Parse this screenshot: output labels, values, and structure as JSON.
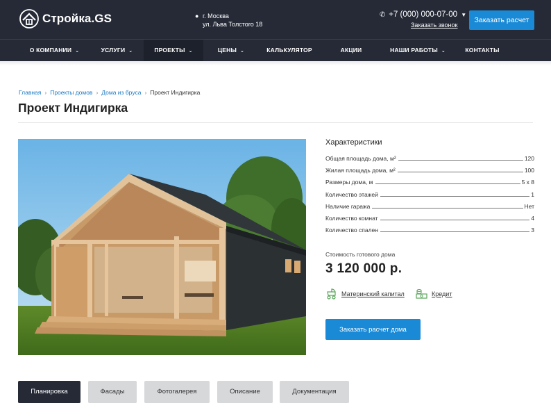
{
  "header": {
    "logo_text": "Стройка.GS",
    "address_line1": "г. Москва",
    "address_line2": "ул. Льва Толстого 18",
    "phone": "+7 (000) 000-07-00",
    "callback": "Заказать звонок",
    "cta": "Заказать расчет"
  },
  "nav": [
    {
      "label": "О КОМПАНИИ",
      "dropdown": true
    },
    {
      "label": "УСЛУГИ",
      "dropdown": true
    },
    {
      "label": "ПРОЕКТЫ",
      "dropdown": true,
      "active": true
    },
    {
      "label": "ЦЕНЫ",
      "dropdown": true
    },
    {
      "label": "КАЛЬКУЛЯТОР",
      "dropdown": false
    },
    {
      "label": "АКЦИИ",
      "dropdown": false
    },
    {
      "label": "НАШИ РАБОТЫ",
      "dropdown": true
    },
    {
      "label": "КОНТАКТЫ",
      "dropdown": false
    }
  ],
  "breadcrumb": [
    "Главная",
    "Проекты домов",
    "Дома из бруса",
    "Проект Индигирка"
  ],
  "page_title": "Проект Индигирка",
  "specs": {
    "title": "Характеристики",
    "rows": [
      {
        "label": "Общая площадь дома, м²",
        "value": "120"
      },
      {
        "label": "Жилая площадь дома, м²",
        "value": "100"
      },
      {
        "label": "Размеры дома, м",
        "value": "5 х 8"
      },
      {
        "label": "Количество этажей",
        "value": "1"
      },
      {
        "label": "Наличие гаража",
        "value": "Нет"
      },
      {
        "label": "Количество комнат",
        "value": "4"
      },
      {
        "label": "Количество спален",
        "value": "3"
      }
    ]
  },
  "price": {
    "label": "Стоимость готового дома",
    "value": "3 120 000 р."
  },
  "links": {
    "maternity": "Материнский капитал",
    "credit": "Кредит"
  },
  "order_button": "Заказать расчет дома",
  "tabs": [
    {
      "label": "Планировка",
      "active": true
    },
    {
      "label": "Фасады"
    },
    {
      "label": "Фотогалерея"
    },
    {
      "label": "Описание"
    },
    {
      "label": "Документация"
    }
  ],
  "colors": {
    "header_bg": "#252a36",
    "accent": "#1a8ad6",
    "link": "#1a7ac4",
    "tab_inactive": "#d7d8da"
  }
}
